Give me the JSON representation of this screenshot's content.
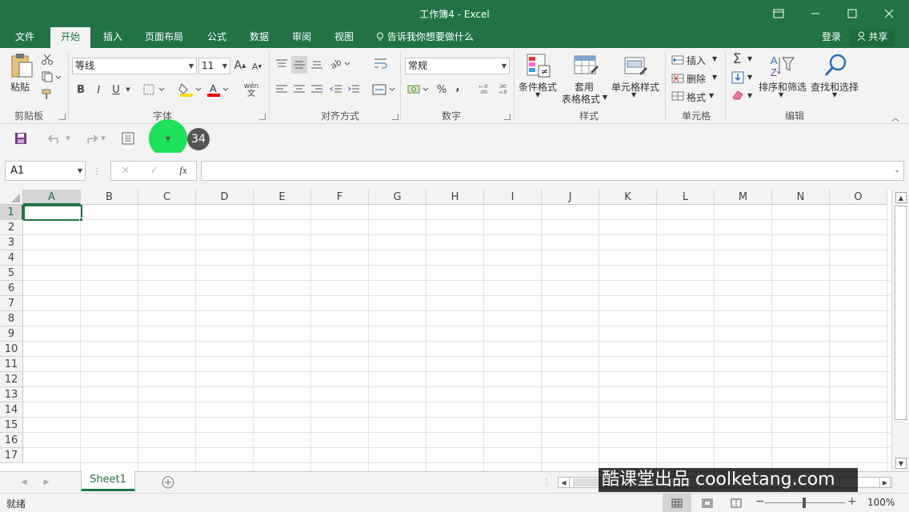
{
  "window": {
    "title": "工作簿4 - Excel"
  },
  "tabs": [
    "文件",
    "开始",
    "插入",
    "页面布局",
    "公式",
    "数据",
    "审阅",
    "视图"
  ],
  "tell_me": "告诉我你想要做什么",
  "account": {
    "login": "登录",
    "share": "共享"
  },
  "ribbon": {
    "clipboard": {
      "paste": "粘贴",
      "group": "剪贴板"
    },
    "font": {
      "name": "等线",
      "size": "11",
      "group": "字体",
      "bold": "B",
      "italic": "I",
      "underline": "U",
      "grow": "A",
      "shrink": "A",
      "wen": "wén",
      "wen_char": "文"
    },
    "alignment": {
      "group": "对齐方式"
    },
    "number": {
      "format": "常规",
      "group": "数字",
      "percent": "%",
      "comma": ",",
      "inc": "←.0 .00",
      "dec": ".00 →.0"
    },
    "styles": {
      "cond": "条件格式",
      "table_1": "套用",
      "table_2": "表格格式",
      "cell": "单元格样式",
      "group": "样式"
    },
    "cells": {
      "insert": "插入",
      "delete": "删除",
      "format": "格式",
      "group": "单元格"
    },
    "editing": {
      "sort": "排序和筛选",
      "find": "查找和选择",
      "group": "编辑",
      "sigma": "Σ"
    }
  },
  "qat": {
    "badge": "34"
  },
  "formula": {
    "name_box": "A1",
    "fx": "fx",
    "cancel": "✕",
    "enter": "✓",
    "value": ""
  },
  "columns": [
    "A",
    "B",
    "C",
    "D",
    "E",
    "F",
    "G",
    "H",
    "I",
    "J",
    "K",
    "L",
    "M",
    "N",
    "O"
  ],
  "rows": [
    "1",
    "2",
    "3",
    "4",
    "5",
    "6",
    "7",
    "8",
    "9",
    "10",
    "11",
    "12",
    "13",
    "14",
    "15",
    "16",
    "17"
  ],
  "sheets": [
    "Sheet1"
  ],
  "status": {
    "ready": "就绪",
    "zoom": "100%"
  },
  "watermark": "酷课堂出品 coolketang.com",
  "colors": {
    "brand": "#217346",
    "highlight": "#1fe05a"
  }
}
